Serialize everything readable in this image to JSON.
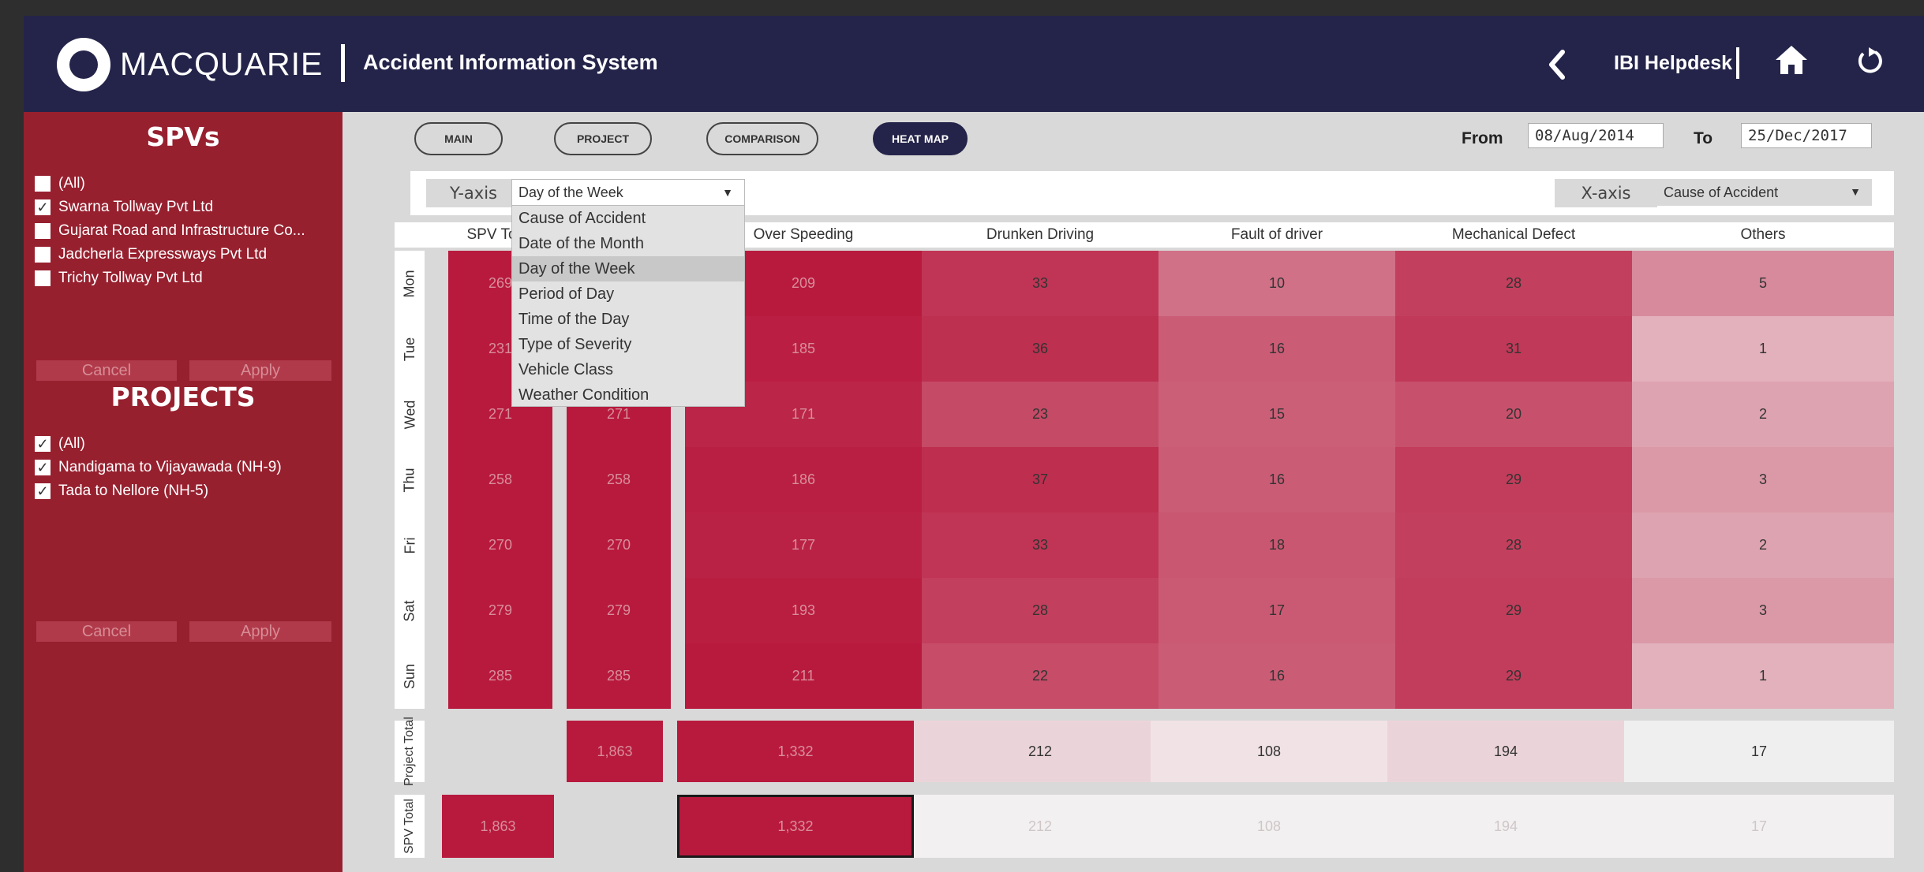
{
  "header": {
    "logo_text": "MACQUARIE",
    "title": "Accident Information System",
    "helpdesk": "IBI Helpdesk"
  },
  "sidebar": {
    "spv_title": "SPVs",
    "spv_items": [
      {
        "label": "(All)",
        "checked": false
      },
      {
        "label": "Swarna Tollway Pvt Ltd",
        "checked": true
      },
      {
        "label": "Gujarat Road and Infrastructure Co...",
        "checked": false
      },
      {
        "label": "Jadcherla Expressways Pvt Ltd",
        "checked": false
      },
      {
        "label": "Trichy Tollway Pvt Ltd",
        "checked": false
      }
    ],
    "projects_title": "PROJECTS",
    "project_items": [
      {
        "label": "(All)",
        "checked": true
      },
      {
        "label": "Nandigama to Vijayawada (NH-9)",
        "checked": true
      },
      {
        "label": "Tada to Nellore (NH-5)",
        "checked": true
      }
    ],
    "cancel_label": "Cancel",
    "apply_label": "Apply"
  },
  "nav": {
    "main": "MAIN",
    "project": "PROJECT",
    "comparison": "COMPARISON",
    "heatmap": "HEAT MAP",
    "active": "HEAT MAP"
  },
  "dates": {
    "from_label": "From",
    "from_value": "08/Aug/2014",
    "to_label": "To",
    "to_value": "25/Dec/2017"
  },
  "axes": {
    "y_label": "Y-axis",
    "y_value": "Day of the Week",
    "x_label": "X-axis",
    "x_value": "Cause of Accident",
    "y_options": [
      "Cause of Accident",
      "Date of the Month",
      "Day of the Week",
      "Period of Day",
      "Time of the Day",
      "Type of Severity",
      "Vehicle Class",
      "Weather Condition"
    ],
    "y_selected": "Day of the Week"
  },
  "table": {
    "columns": [
      "SPV To",
      "Over Speeding",
      "Drunken Driving",
      "Fault of driver",
      "Mechanical Defect",
      "Others"
    ],
    "rows": [
      {
        "label": "Mon",
        "spv": "269",
        "proj": "",
        "values": [
          "209",
          "33",
          "10",
          "28",
          "5"
        ]
      },
      {
        "label": "Tue",
        "spv": "231",
        "proj": "",
        "values": [
          "185",
          "36",
          "16",
          "31",
          "1"
        ]
      },
      {
        "label": "Wed",
        "spv": "271",
        "proj": "271",
        "values": [
          "171",
          "23",
          "15",
          "20",
          "2"
        ]
      },
      {
        "label": "Thu",
        "spv": "258",
        "proj": "258",
        "values": [
          "186",
          "37",
          "16",
          "29",
          "3"
        ]
      },
      {
        "label": "Fri",
        "spv": "270",
        "proj": "270",
        "values": [
          "177",
          "33",
          "18",
          "28",
          "2"
        ]
      },
      {
        "label": "Sat",
        "spv": "279",
        "proj": "279",
        "values": [
          "193",
          "28",
          "17",
          "29",
          "3"
        ]
      },
      {
        "label": "Sun",
        "spv": "285",
        "proj": "285",
        "values": [
          "211",
          "22",
          "16",
          "29",
          "1"
        ]
      }
    ],
    "project_total": {
      "label": "Project Total",
      "proj": "1,863",
      "values": [
        "1,332",
        "212",
        "108",
        "194",
        "17"
      ]
    },
    "spv_total": {
      "label": "SPV Total",
      "spv": "1,863",
      "values": [
        "1,332",
        "212",
        "108",
        "194",
        "17"
      ]
    }
  },
  "colors": {
    "header_bg": "#24244a",
    "sidebar_bg": "#97202f",
    "heat_dark": "#b81a3e",
    "heat_light": "#f0e6e8"
  }
}
